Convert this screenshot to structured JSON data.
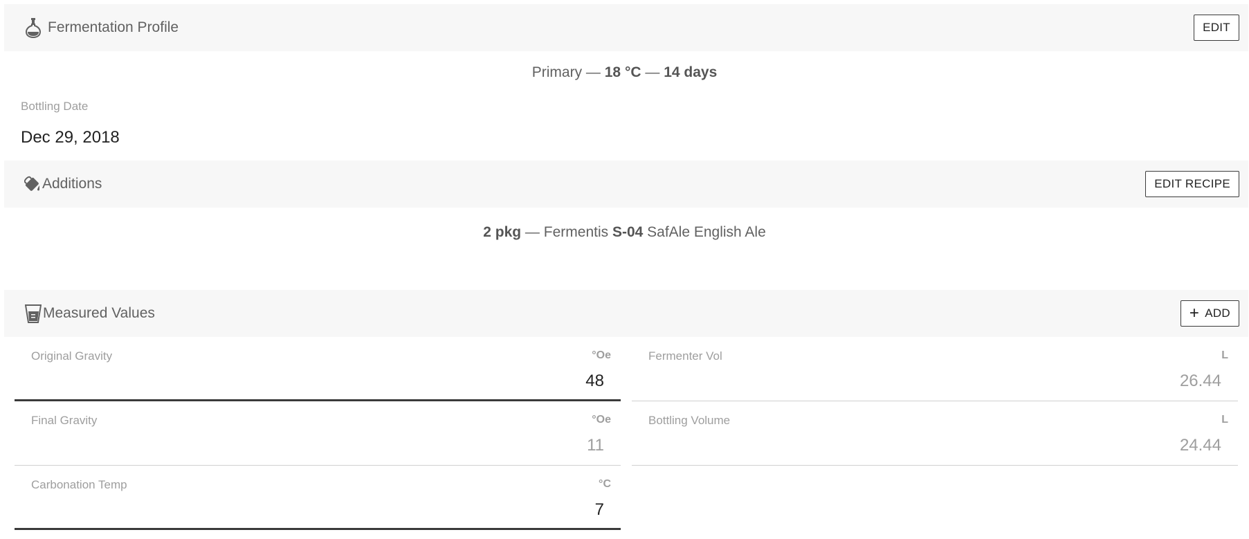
{
  "fermentation": {
    "title": "Fermentation Profile",
    "edit_label": "EDIT",
    "icon": "flask-icon",
    "step": {
      "name": "Primary",
      "sep1": " — ",
      "temp": "18 °C",
      "sep2": " — ",
      "duration": "14 days"
    }
  },
  "bottling": {
    "label": "Bottling Date",
    "value": "Dec 29, 2018"
  },
  "additions": {
    "title": "Additions",
    "edit_label": "EDIT RECIPE",
    "icon": "paint-bucket-icon",
    "item": {
      "amount": "2 pkg",
      "sep": " — ",
      "brand": "Fermentis ",
      "code": "S-04",
      "name": " SafAle English Ale"
    }
  },
  "measured": {
    "title": "Measured Values",
    "add_label": "ADD",
    "icon": "measure-icon",
    "fields": {
      "og": {
        "label": "Original Gravity",
        "unit": "°Oe",
        "value": "48"
      },
      "fv": {
        "label": "Fermenter Vol",
        "unit": "L",
        "value": "26.44"
      },
      "fg": {
        "label": "Final Gravity",
        "unit": "°Oe",
        "value": "11"
      },
      "bv": {
        "label": "Bottling Volume",
        "unit": "L",
        "value": "24.44"
      },
      "ct": {
        "label": "Carbonation Temp",
        "unit": "°C",
        "value": "7"
      }
    }
  }
}
